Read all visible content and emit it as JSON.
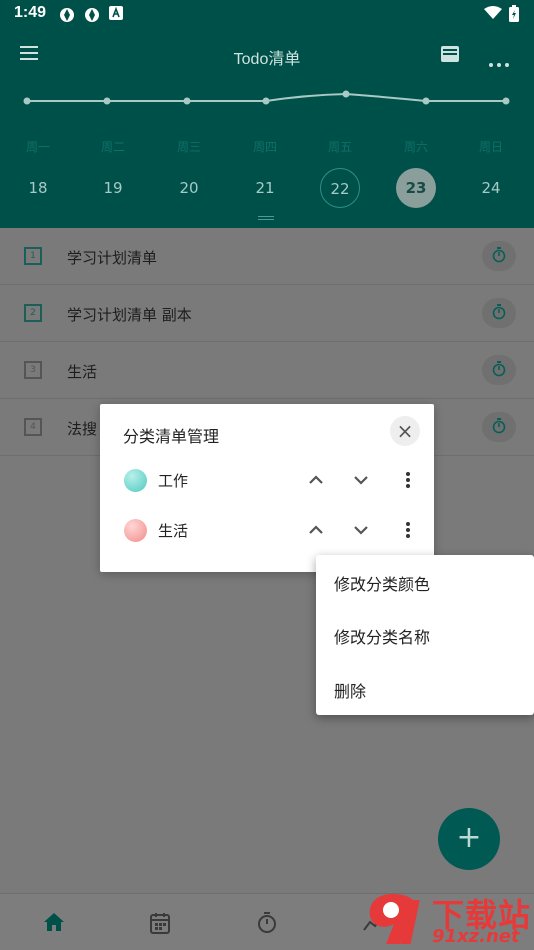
{
  "status_bar": {
    "time": "1:49"
  },
  "header": {
    "title": "Todo清单",
    "weekdays": [
      "周一",
      "周二",
      "周三",
      "周四",
      "周五",
      "周六",
      "周日"
    ],
    "dates": [
      "18",
      "19",
      "20",
      "21",
      "22",
      "23",
      "24"
    ]
  },
  "list": {
    "items": [
      {
        "number": "1",
        "label": "学习计划清单"
      },
      {
        "number": "2",
        "label": "学习计划清单 副本"
      },
      {
        "number": "3",
        "label": "生活"
      },
      {
        "number": "4",
        "label": "法搜"
      }
    ]
  },
  "dialog": {
    "title": "分类清单管理",
    "close_symbol": "×",
    "categories": [
      {
        "label": "工作",
        "color": "#4ec9c0"
      },
      {
        "label": "生活",
        "color": "#f08c8a"
      }
    ]
  },
  "popup_menu": {
    "items": [
      "修改分类颜色",
      "修改分类名称",
      "删除"
    ]
  },
  "fab": {
    "symbol": "+"
  },
  "watermark": {
    "brand": "下载站",
    "url": "91xz.net"
  },
  "colors": {
    "primary": "#00897b",
    "accent_teal": "#4ec9c0",
    "accent_pink": "#f08c8a"
  }
}
